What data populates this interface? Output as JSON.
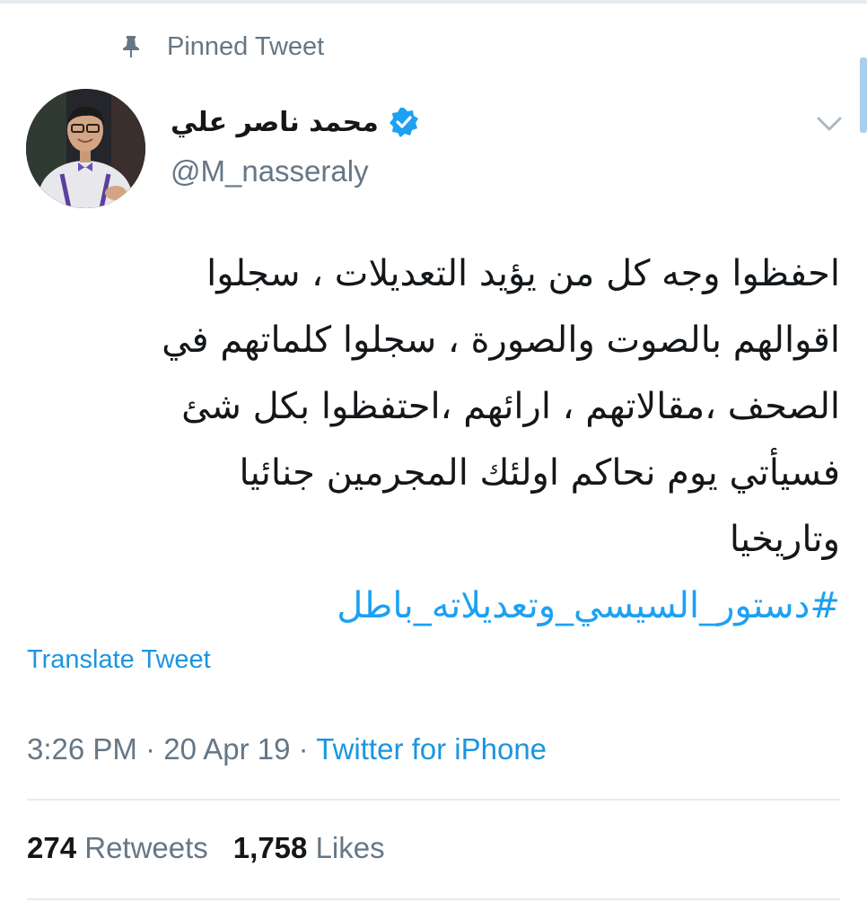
{
  "pinned": {
    "label": "Pinned Tweet",
    "icon": "pin-icon"
  },
  "author": {
    "display_name": "محمد ناصر علي",
    "handle": "@M_nasseraly",
    "verified": true,
    "verified_icon": "verified-badge-icon"
  },
  "menu": {
    "icon": "chevron-down-icon"
  },
  "tweet": {
    "lines": [
      "احفظوا وجه كل من يؤيد التعديلات ، سجلوا",
      "اقوالهم بالصوت والصورة ، سجلوا كلماتهم في",
      "الصحف ،مقالاتهم ، ارائهم ،احتفظوا بكل شئ",
      "فسيأتي يوم نحاكم اولئك المجرمين جنائيا",
      "وتاريخيا"
    ],
    "hashtag": "#دستور_السيسي_وتعديلاته_باطل"
  },
  "translate": {
    "label": "Translate Tweet"
  },
  "meta": {
    "time": "3:26 PM",
    "separator": " · ",
    "date": "20 Apr 19",
    "source": "Twitter for iPhone"
  },
  "stats": {
    "retweets_count": "274",
    "retweets_label": "Retweets",
    "likes_count": "1,758",
    "likes_label": "Likes"
  },
  "colors": {
    "link": "#1b95e0",
    "hashtag": "#1da1f2",
    "secondary_text": "#657786",
    "primary_text": "#14171a",
    "divider": "#e6ecf0"
  }
}
